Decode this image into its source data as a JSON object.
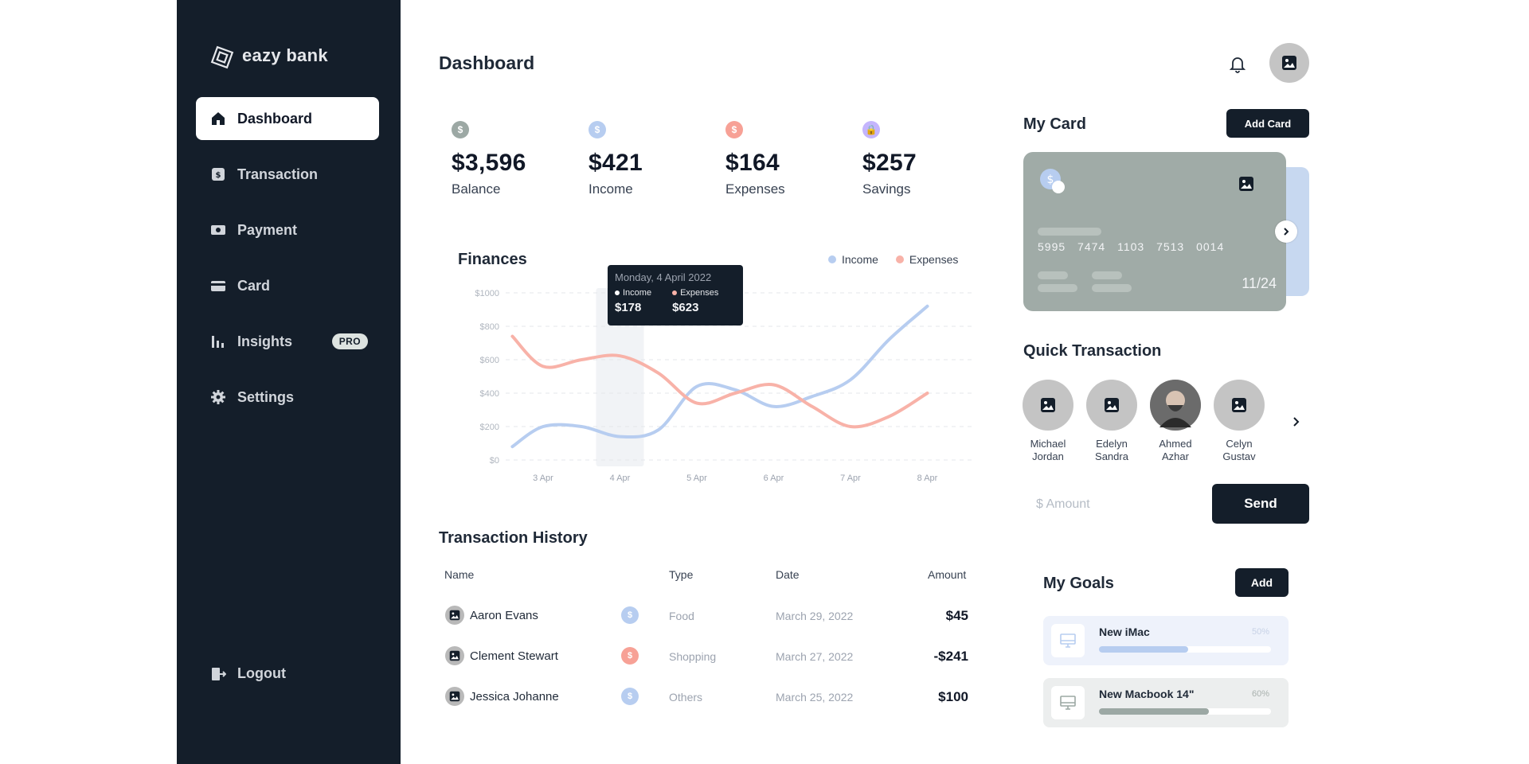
{
  "brand": {
    "name": "eazy bank"
  },
  "sidebar": {
    "items": [
      {
        "label": "Dashboard",
        "icon": "home-icon"
      },
      {
        "label": "Transaction",
        "icon": "transaction-icon"
      },
      {
        "label": "Payment",
        "icon": "payment-icon"
      },
      {
        "label": "Card",
        "icon": "card-icon"
      },
      {
        "label": "Insights",
        "icon": "chart-icon",
        "badge": "PRO"
      },
      {
        "label": "Settings",
        "icon": "gear-icon"
      }
    ],
    "logout": "Logout"
  },
  "header": {
    "title": "Dashboard"
  },
  "stats": [
    {
      "value": "$3,596",
      "label": "Balance",
      "symbol": "$",
      "color": "#9ca8a4"
    },
    {
      "value": "$421",
      "label": "Income",
      "symbol": "$",
      "color": "#b7cdf0"
    },
    {
      "value": "$164",
      "label": "Expenses",
      "symbol": "$",
      "color": "#f7a196"
    },
    {
      "value": "$257",
      "label": "Savings",
      "symbol": "🔒",
      "color": "#c4b5fd"
    }
  ],
  "chart_data": {
    "type": "line",
    "title": "Finances",
    "categories": [
      "3 Apr",
      "4 Apr",
      "5 Apr",
      "6 Apr",
      "7 Apr",
      "8 Apr"
    ],
    "series": [
      {
        "name": "Income",
        "color": "#b7cdf0",
        "x": [
          2.6,
          3,
          3.5,
          4,
          4.5,
          5,
          5.5,
          6,
          6.5,
          7,
          7.5,
          8
        ],
        "values": [
          80,
          200,
          200,
          140,
          180,
          440,
          420,
          320,
          380,
          480,
          720,
          920
        ]
      },
      {
        "name": "Expenses",
        "color": "#f8b2a8",
        "x": [
          2.6,
          3,
          3.5,
          4,
          4.5,
          5,
          5.5,
          6,
          6.5,
          7,
          7.5,
          8
        ],
        "values": [
          740,
          560,
          600,
          623,
          520,
          340,
          400,
          450,
          320,
          200,
          260,
          400
        ]
      }
    ],
    "y_ticks": [
      "$0",
      "$200",
      "$400",
      "$600",
      "$800",
      "$1000"
    ],
    "ylim": [
      0,
      1000
    ],
    "grid": true,
    "highlight_category": "4 Apr",
    "tooltip": {
      "date": "Monday, 4 April 2022",
      "income_label": "Income",
      "income_value": "$178",
      "expenses_label": "Expenses",
      "expenses_value": "$623"
    }
  },
  "transactions": {
    "title": "Transaction History",
    "columns": {
      "name": "Name",
      "type": "Type",
      "date": "Date",
      "amount": "Amount"
    },
    "rows": [
      {
        "name": "Aaron Evans",
        "type": "Food",
        "date": "March 29, 2022",
        "amount": "$45",
        "cat_color": "#b7cdf0"
      },
      {
        "name": "Clement Stewart",
        "type": "Shopping",
        "date": "March 27, 2022",
        "amount": "-$241",
        "cat_color": "#f7a196"
      },
      {
        "name": "Jessica Johanne",
        "type": "Others",
        "date": "March 25, 2022",
        "amount": "$100",
        "cat_color": "#b7cdf0"
      }
    ]
  },
  "my_card": {
    "title": "My Card",
    "add_label": "Add Card",
    "number": "5995 7474 1103 7513 0014",
    "expiry": "11/24"
  },
  "quick_transaction": {
    "title": "Quick Transaction",
    "people": [
      {
        "first": "Michael",
        "last": "Jordan"
      },
      {
        "first": "Edelyn",
        "last": "Sandra"
      },
      {
        "first": "Ahmed",
        "last": "Azhar"
      },
      {
        "first": "Celyn",
        "last": "Gustav"
      }
    ],
    "amount_placeholder": "$ Amount",
    "send_label": "Send"
  },
  "goals": {
    "title": "My Goals",
    "add_label": "Add",
    "items": [
      {
        "name": "New iMac",
        "percent": "50%",
        "progress": 0.52,
        "fill": "#b7cdf0",
        "bg": "#eef2fb",
        "pct_color": "#c7d2e6"
      },
      {
        "name": "New Macbook 14\"",
        "percent": "60%",
        "progress": 0.64,
        "fill": "#9ca8a4",
        "bg": "#eceeee",
        "pct_color": "#a9b1ae"
      }
    ]
  }
}
